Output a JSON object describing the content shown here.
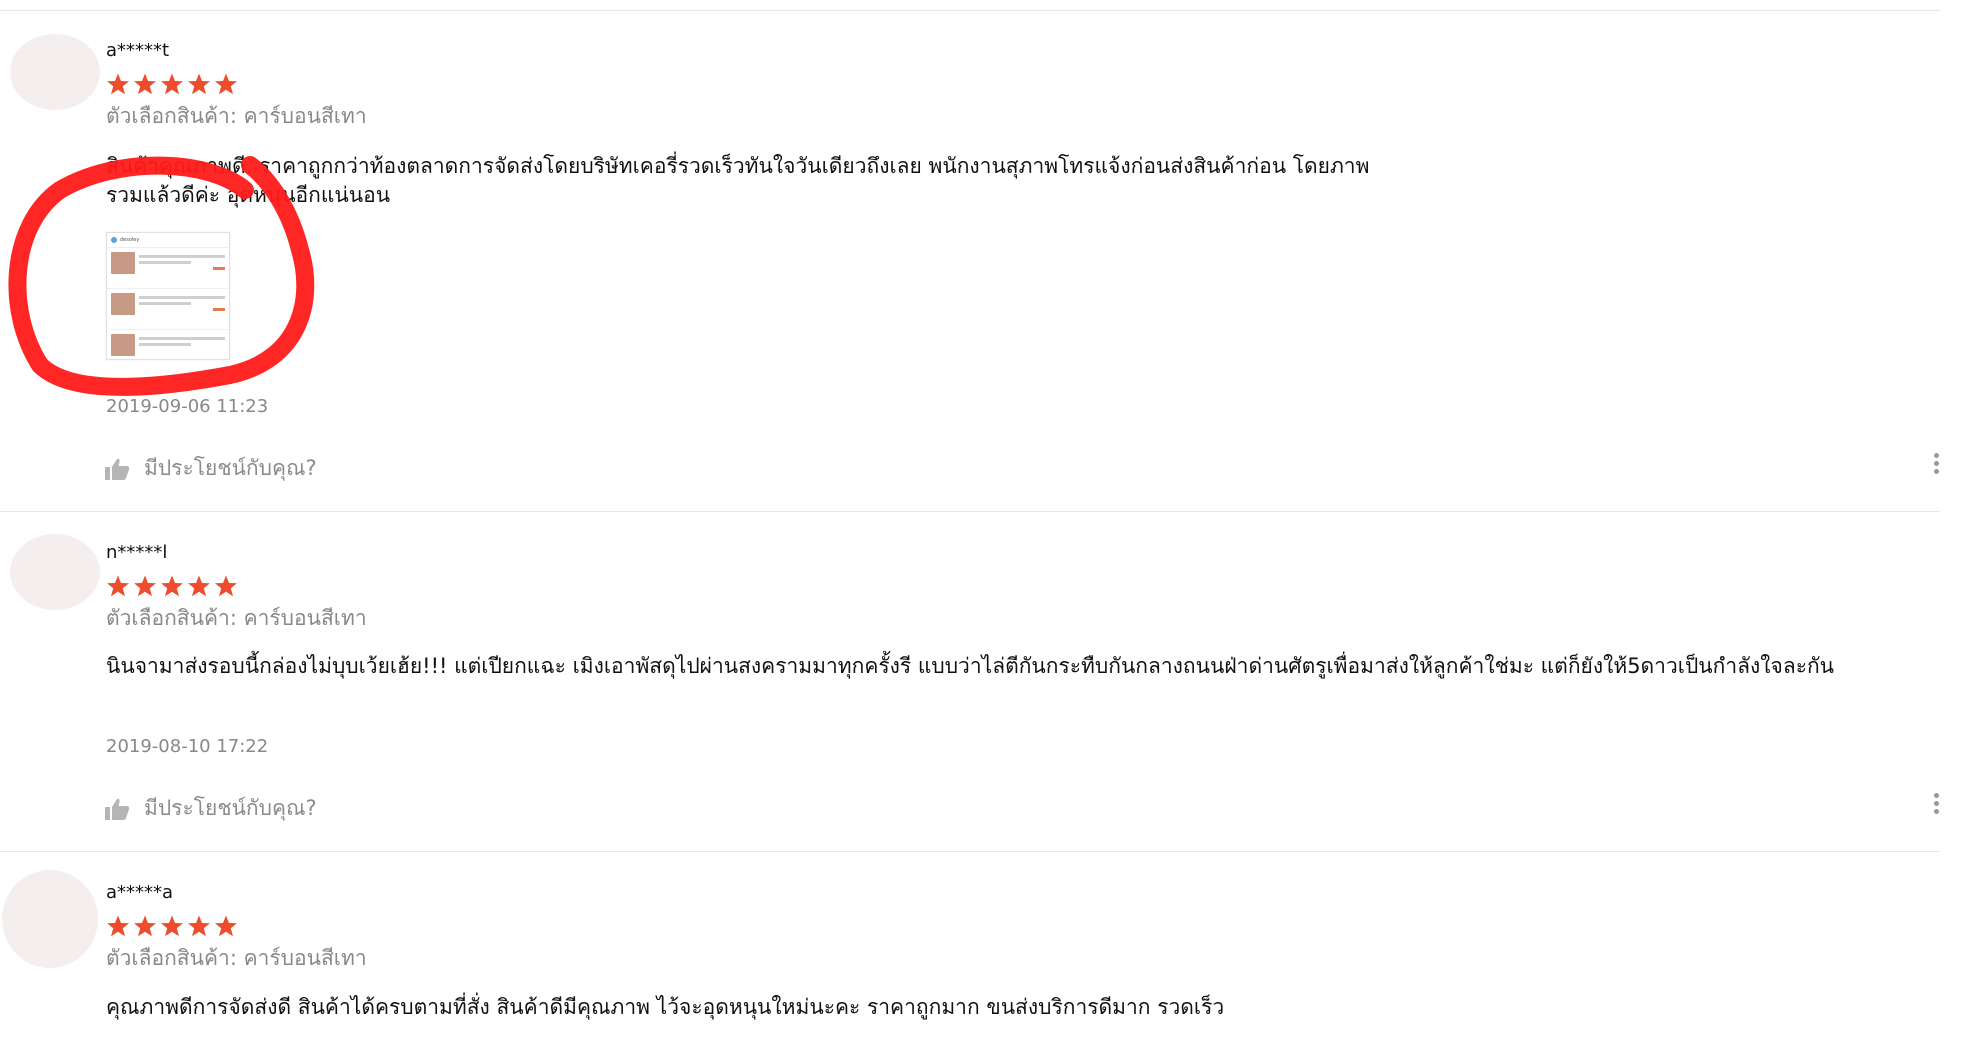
{
  "colors": {
    "star": "#ee4d2d",
    "annotation": "#ff0000",
    "muted": "#888888"
  },
  "reviews": [
    {
      "username": "a*****t",
      "rating": 5,
      "variation": "ตัวเลือกสินค้า: คาร์บอนสีเทา",
      "comment": "สินค้าคุณภาพดี. ราคาถูกกว่าท้องตลาดการจัดส่งโดยบริษัทเคอรี่รวดเร็วทันใจวันเดียวถึงเลย พนักงานสุภาพโทรแจ้งก่อนส่งสินค้าก่อน โดยภาพรวมแล้วดีค่ะ อุดหนุนอีกแน่นอน",
      "timestamp": "2019-09-06 11:23",
      "helpful_label": "มีประโยชน์กับคุณ?",
      "has_media": true,
      "media": {
        "shop_label": "desoley"
      }
    },
    {
      "username": "n*****l",
      "rating": 5,
      "variation": "ตัวเลือกสินค้า: คาร์บอนสีเทา",
      "comment": "นินจามาส่งรอบนี้กล่องไม่บุบเว้ยเฮ้ย!!! แต่เปียกแฉะ เมิงเอาพัสดุไปผ่านสงครามมาทุกครั้งรี แบบว่าไล่ตีกันกระทืบกันกลางถนนฝ่าด่านศัตรูเพื่อมาส่งให้ลูกค้าใช่มะ แต่ก็ยังให้5ดาวเป็นกำลังใจละกัน",
      "timestamp": "2019-08-10 17:22",
      "helpful_label": "มีประโยชน์กับคุณ?",
      "has_media": false
    },
    {
      "username": "a*****a",
      "rating": 5,
      "variation": "ตัวเลือกสินค้า: คาร์บอนสีเทา",
      "comment": "คุณภาพดีการจัดส่งดี สินค้าได้ครบตามที่สั่ง สินค้าดีมีคุณภาพ ไว้จะอุดหนุนใหม่นะคะ ราคาถูกมาก ขนส่งบริการดีมาก รวดเร็ว",
      "has_media": false
    }
  ]
}
